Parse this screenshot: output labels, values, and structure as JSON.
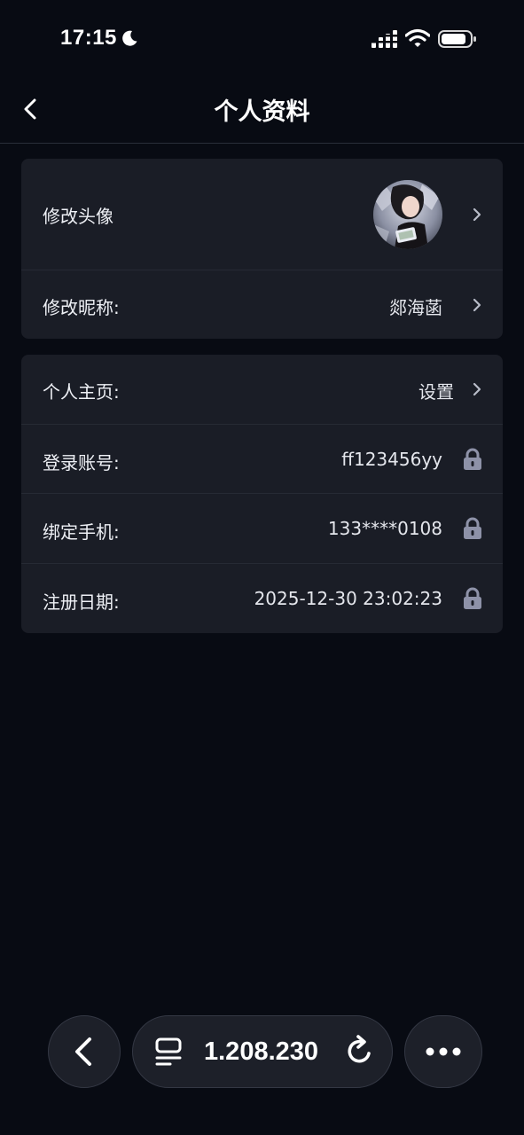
{
  "status_bar": {
    "time": "17:15"
  },
  "nav": {
    "title": "个人资料"
  },
  "profile": {
    "avatar_label": "修改头像",
    "nickname_label": "修改昵称:",
    "nickname_value": "郯海菡",
    "homepage_label": "个人主页:",
    "homepage_value": "设置",
    "account_label": "登录账号:",
    "account_value": "ff123456yy",
    "phone_label": "绑定手机:",
    "phone_value": "133****0108",
    "register_label": "注册日期:",
    "register_value": "2025-12-30 23:02:23"
  },
  "browser": {
    "url": "1.208.230"
  },
  "icons": {
    "back": "back-icon",
    "chevron": "chevron-right-icon",
    "lock": "lock-icon",
    "more": "more-icon",
    "reload": "reload-icon",
    "tabs": "tabs-icon"
  },
  "colors": {
    "background": "#080b13",
    "card": "#1a1d26",
    "lock": "#8e92a8"
  }
}
